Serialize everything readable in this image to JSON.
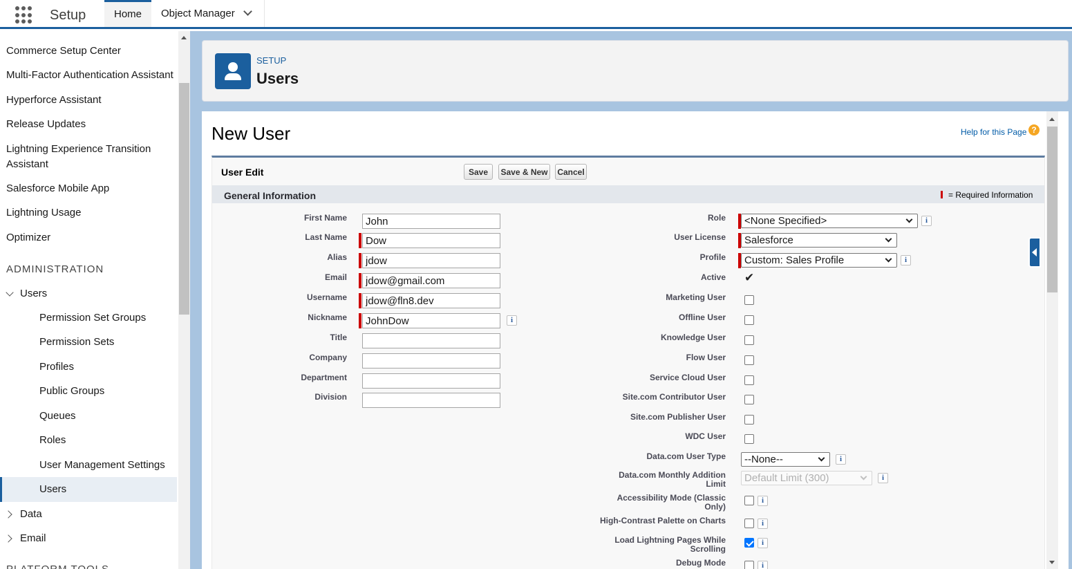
{
  "topbar": {
    "app_name": "Setup",
    "tabs": [
      {
        "label": "Home"
      },
      {
        "label": "Object Manager"
      }
    ]
  },
  "sidebar": {
    "items": [
      {
        "label": "Commerce Setup Center"
      },
      {
        "label": "Multi-Factor Authentication Assistant"
      },
      {
        "label": "Hyperforce Assistant"
      },
      {
        "label": "Release Updates"
      },
      {
        "label": "Lightning Experience Transition Assistant"
      },
      {
        "label": "Salesforce Mobile App"
      },
      {
        "label": "Lightning Usage"
      },
      {
        "label": "Optimizer"
      }
    ],
    "section_header": "ADMINISTRATION",
    "users_group": "Users",
    "user_subitems": [
      {
        "label": "Permission Set Groups"
      },
      {
        "label": "Permission Sets"
      },
      {
        "label": "Profiles"
      },
      {
        "label": "Public Groups"
      },
      {
        "label": "Queues"
      },
      {
        "label": "Roles"
      },
      {
        "label": "User Management Settings"
      },
      {
        "label": "Users"
      }
    ],
    "data_group": "Data",
    "email_group": "Email",
    "platform_tools": "PLATFORM TOOLS"
  },
  "header": {
    "breadcrumb": "SETUP",
    "title": "Users"
  },
  "page": {
    "title": "New User",
    "help_link": "Help for this Page",
    "help_icon": "question-icon"
  },
  "edit": {
    "title": "User Edit",
    "save_label": "Save",
    "save_new_label": "Save & New",
    "cancel_label": "Cancel",
    "section_title": "General Information",
    "required_info": "= Required Information"
  },
  "left_fields": [
    {
      "label": "First Name",
      "value": "John"
    },
    {
      "label": "Last Name",
      "value": "Dow"
    },
    {
      "label": "Alias",
      "value": "jdow"
    },
    {
      "label": "Email",
      "value": "jdow@gmail.com"
    },
    {
      "label": "Username",
      "value": "jdow@fln8.dev"
    },
    {
      "label": "Nickname",
      "value": "JohnDow"
    },
    {
      "label": "Title",
      "value": ""
    },
    {
      "label": "Company",
      "value": ""
    },
    {
      "label": "Department",
      "value": ""
    },
    {
      "label": "Division",
      "value": ""
    }
  ],
  "right_fields": {
    "role": {
      "label": "Role",
      "value": "<None Specified>"
    },
    "user_license": {
      "label": "User License",
      "value": "Salesforce"
    },
    "profile": {
      "label": "Profile",
      "value": "Custom: Sales Profile"
    },
    "active": {
      "label": "Active",
      "glyph": "✔"
    },
    "marketing_user": {
      "label": "Marketing User"
    },
    "offline_user": {
      "label": "Offline User"
    },
    "knowledge_user": {
      "label": "Knowledge User"
    },
    "flow_user": {
      "label": "Flow User"
    },
    "service_cloud_user": {
      "label": "Service Cloud User"
    },
    "site_contributor": {
      "label": "Site.com Contributor User"
    },
    "site_publisher": {
      "label": "Site.com Publisher User"
    },
    "wdc_user": {
      "label": "WDC User"
    },
    "datacom_type": {
      "label": "Data.com User Type",
      "value": "--None--"
    },
    "datacom_limit": {
      "label_line1": "Data.com Monthly Addition",
      "label_line2": "Limit",
      "value": "Default Limit (300)"
    },
    "accessibility": {
      "label_line1": "Accessibility Mode (Classic",
      "label_line2": "Only)"
    },
    "high_contrast": {
      "label": "High-Contrast Palette on Charts"
    },
    "load_lightning": {
      "label_line1": "Load Lightning Pages While",
      "label_line2": "Scrolling",
      "checked": true
    },
    "debug_mode": {
      "label": "Debug Mode"
    }
  },
  "info_glyph": "i"
}
